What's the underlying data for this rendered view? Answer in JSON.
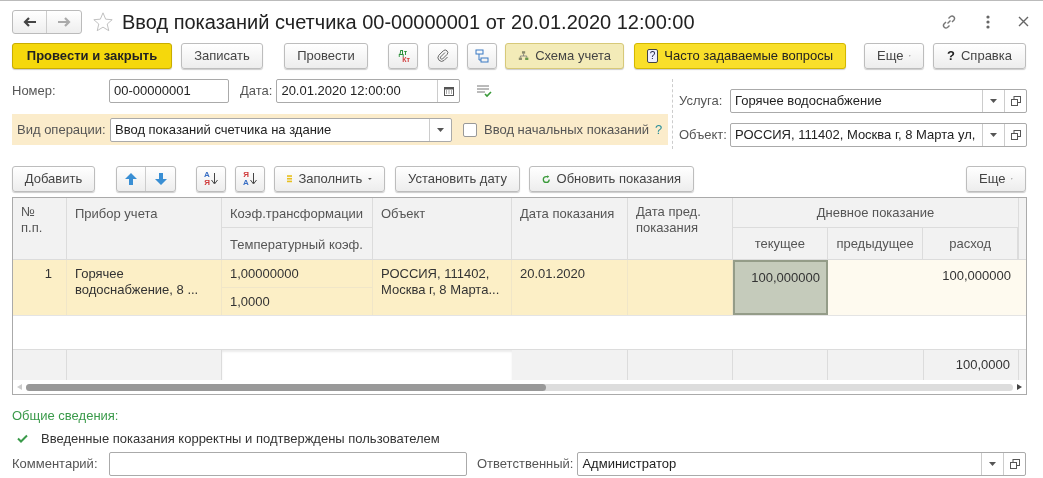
{
  "window": {
    "title": "Ввод показаний счетчика 00-00000001 от 20.01.2020 12:00:00"
  },
  "toolbar": {
    "post_close": "Провести и закрыть",
    "save": "Записать",
    "post": "Провести",
    "dt": "Дт",
    "kt": "Кт",
    "scheme": "Схема учета",
    "faq_icon": "?",
    "faq": "Часто задаваемые вопросы",
    "more": "Еще",
    "help_icon": "?",
    "help": "Справка"
  },
  "header": {
    "number": {
      "label": "Номер:",
      "value": "00-00000001"
    },
    "date": {
      "label": "Дата:",
      "value": "20.01.2020 12:00:00"
    },
    "operation": {
      "label": "Вид операции:",
      "value": "Ввод показаний счетчика на здание"
    },
    "initial_readings": {
      "label": "Ввод начальных показаний",
      "checked": false,
      "hint": "?"
    },
    "service": {
      "label": "Услуга:",
      "value": "Горячее водоснабжение"
    },
    "object": {
      "label": "Объект:",
      "value": "РОССИЯ, 111402, Москва г, 8 Марта ул,"
    }
  },
  "table_toolbar": {
    "add": "Добавить",
    "sort_asc": {
      "top": "А",
      "bottom": "Я"
    },
    "sort_desc": {
      "top": "Я",
      "bottom": "А"
    },
    "fill": "Заполнить",
    "set_date": "Установить дату",
    "refresh": "Обновить показания",
    "more": "Еще"
  },
  "table": {
    "columns": {
      "number": "№ п.п.",
      "device": "Прибор учета",
      "coef_transform": "Коэф.трансформации",
      "coef_temp": "Температурный коэф.",
      "object": "Объект",
      "reading_date": "Дата показания",
      "prev_date": "Дата пред. показания",
      "daily": "Дневное показание",
      "current": "текущее",
      "previous": "предыдущее",
      "consumption": "расход"
    },
    "rows": [
      {
        "selected": true,
        "number": "1",
        "device": "Горячее водоснабжение, 8 ...",
        "coef_transform": "1,00000000",
        "coef_temp": "1,0000",
        "object": "РОССИЯ, 111402, Москва г, 8 Марта...",
        "reading_date": "20.01.2020",
        "current": {
          "value": "100,000000",
          "selected": true
        },
        "consumption": {
          "value": "100,000000",
          "selected": false
        }
      }
    ],
    "totals": {
      "consumption": "100,0000"
    }
  },
  "info": {
    "title": "Общие сведения:",
    "confirmed": {
      "checked": true,
      "text": "Введенные показания корректны и подтверждены пользователем"
    }
  },
  "footer": {
    "comment": {
      "label": "Комментарий:"
    },
    "responsible": {
      "label": "Ответственный:",
      "value": "Администратор"
    }
  }
}
